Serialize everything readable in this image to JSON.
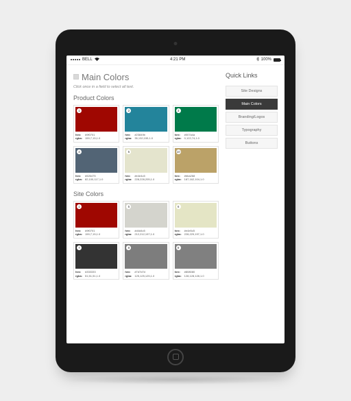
{
  "statusbar": {
    "carrier": "BELL",
    "wifi": "wifi",
    "time": "4:21 PM",
    "battery_pct": "100%"
  },
  "page": {
    "title": "Main Colors",
    "hint": "Click once in a field to select all text."
  },
  "sections": {
    "product": {
      "heading": "Product Colors",
      "swatches": [
        {
          "n": "1",
          "color": "#9f0701",
          "hex": "#9f0701",
          "rgba": "159,7,15,1.0"
        },
        {
          "n": "2",
          "color": "#23849b",
          "hex": "#23849b",
          "rgba": "35,132,155,1.0"
        },
        {
          "n": "3",
          "color": "#007a4a",
          "hex": "#007a4a",
          "rgba": "0,122,74,1.0"
        },
        {
          "n": "4",
          "color": "#526475",
          "hex": "#526475",
          "rgba": "82,100,117,1.0"
        },
        {
          "n": "5",
          "color": "#e4e4cd",
          "hex": "#e4e4c5",
          "rgba": "228,228,205,1.0"
        },
        {
          "n": "10",
          "color": "#bba268",
          "hex": "#bba268",
          "rgba": "187,162,104,1.0"
        }
      ]
    },
    "site": {
      "heading": "Site Colors",
      "swatches": [
        {
          "n": "1",
          "color": "#9f0701",
          "hex": "#9f0701",
          "rgba": "159,7,15,1.0"
        },
        {
          "n": "5",
          "color": "#d4d4cd",
          "hex": "#d4d4c5",
          "rgba": "212,212,197,1.0"
        },
        {
          "n": "6",
          "color": "#e4e5c5",
          "hex": "#e4e5c5",
          "rgba": "228,229,197,1.0"
        },
        {
          "n": "7",
          "color": "#333333",
          "hex": "#333333",
          "rgba": "51,51,51,1.0"
        },
        {
          "n": "8",
          "color": "#7d7d7d",
          "hex": "#7d7d7d",
          "rgba": "125,125,125,1.0"
        },
        {
          "n": "9",
          "color": "#808080",
          "hex": "#808080",
          "rgba": "128,128,128,1.0"
        }
      ]
    }
  },
  "quicklinks": {
    "heading": "Quick Links",
    "items": [
      {
        "label": "Site Designs",
        "active": false
      },
      {
        "label": "Main Colors",
        "active": true
      },
      {
        "label": "Branding/Logos",
        "active": false
      },
      {
        "label": "Typography",
        "active": false
      },
      {
        "label": "Buttons",
        "active": false
      }
    ]
  },
  "labels": {
    "hex": "hex:",
    "rgba": "rgba:"
  }
}
